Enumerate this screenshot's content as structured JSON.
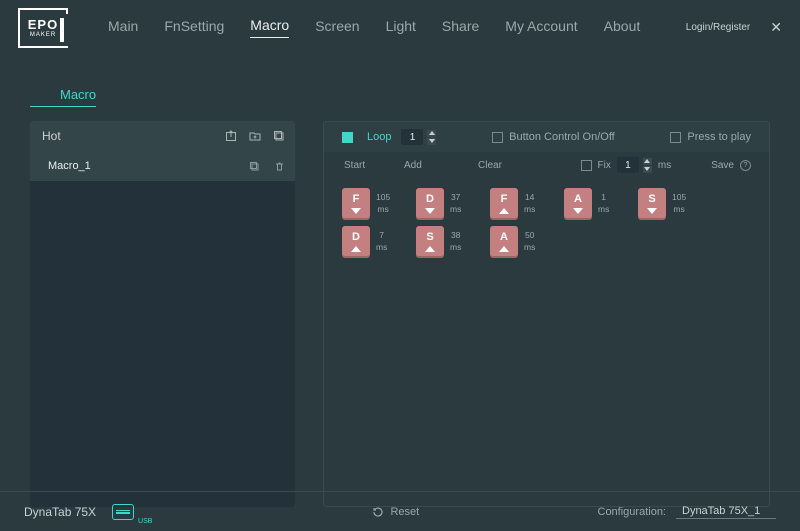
{
  "topbar": {
    "logo_line1": "EPO",
    "logo_line2": "MAKER",
    "login": "Login/Register"
  },
  "nav": {
    "items": [
      "Main",
      "FnSetting",
      "Macro",
      "Screen",
      "Light",
      "Share",
      "My Account",
      "About"
    ],
    "active_index": 2
  },
  "section_title": "Macro",
  "left": {
    "header_label": "Hot",
    "macros": [
      {
        "name": "Macro_1"
      }
    ]
  },
  "ctrl": {
    "loop_on": true,
    "loop_label": "Loop",
    "loop_value": "1",
    "button_control_label": "Button Control On/Off",
    "button_control_on": false,
    "press_to_play_label": "Press to play",
    "press_to_play_on": false
  },
  "sub": {
    "start": "Start",
    "add": "Add",
    "clear": "Clear",
    "fix": "Fix",
    "fix_value": "1",
    "fix_unit": "ms",
    "save": "Save"
  },
  "steps": [
    {
      "key": "F",
      "dir": "down",
      "t": "105",
      "u": "ms"
    },
    {
      "key": "D",
      "dir": "down",
      "t": "37",
      "u": "ms"
    },
    {
      "key": "F",
      "dir": "up",
      "t": "14",
      "u": "ms"
    },
    {
      "key": "A",
      "dir": "down",
      "t": "1",
      "u": "ms"
    },
    {
      "key": "S",
      "dir": "down",
      "t": "105",
      "u": "ms"
    },
    {
      "key": "D",
      "dir": "up",
      "t": "7",
      "u": "ms"
    },
    {
      "key": "S",
      "dir": "up",
      "t": "38",
      "u": "ms"
    },
    {
      "key": "A",
      "dir": "up",
      "t": "50",
      "u": "ms"
    }
  ],
  "status": {
    "device": "DynaTab 75X",
    "conn_mode": "USB",
    "reset": "Reset",
    "config_label": "Configuration:",
    "config_value": "DynaTab 75X_1"
  }
}
